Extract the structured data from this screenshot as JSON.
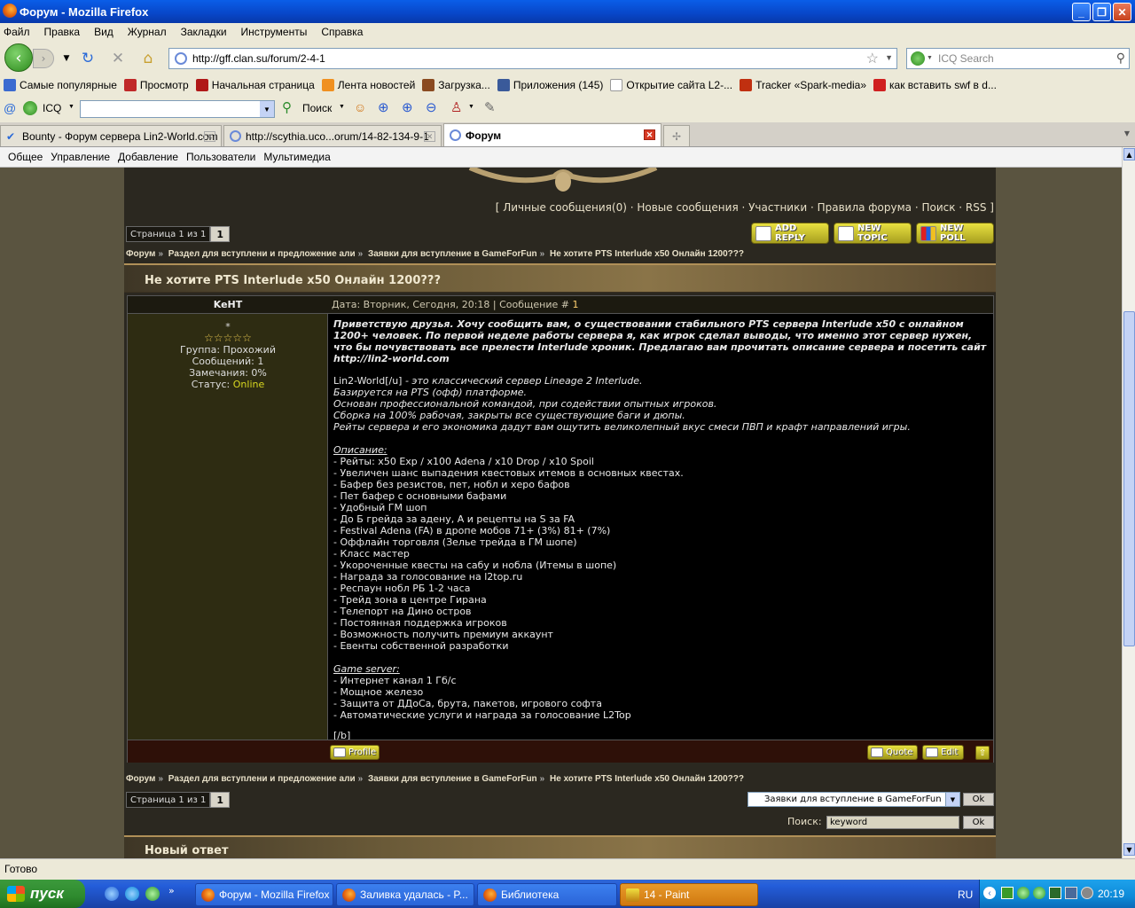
{
  "window": {
    "title": "Форум - Mozilla Firefox"
  },
  "menu": [
    "Файл",
    "Правка",
    "Вид",
    "Журнал",
    "Закладки",
    "Инструменты",
    "Справка"
  ],
  "nav": {
    "url": "http://gff.clan.su/forum/2-4-1",
    "search_placeholder": "ICQ Search"
  },
  "bookmarks": [
    {
      "label": "Самые популярные",
      "color": "#3a6ad0"
    },
    {
      "label": "Просмотр",
      "color": "#c02828"
    },
    {
      "label": "Начальная страница",
      "color": "#b01818"
    },
    {
      "label": "Лента новостей",
      "color": "#f09020"
    },
    {
      "label": "Загрузка...",
      "color": "#8a4a20"
    },
    {
      "label": "Приложения (145)",
      "color": "#3a5a9a"
    },
    {
      "label": "Открытие сайта L2-...",
      "color": "#dddddd"
    },
    {
      "label": "Tracker «Spark-media»",
      "color": "#c03010"
    },
    {
      "label": "как вставить swf в d...",
      "color": "#d02020"
    }
  ],
  "toolbar2": {
    "icq_label": "ICQ",
    "search_label": "Поиск"
  },
  "tabs": [
    {
      "label": "Bounty - Форум сервера Lin2-World.com",
      "active": false
    },
    {
      "label": "http://scythia.uco...orum/14-82-134-9-1",
      "active": false
    },
    {
      "label": "Форум",
      "active": true
    }
  ],
  "ucoz_menu": [
    "Общее",
    "Управление",
    "Добавление",
    "Пользователи",
    "Мультимедиа"
  ],
  "forum": {
    "top_links": "[ Личные сообщения(0) · Новые сообщения · Участники · Правила форума · Поиск · RSS ]",
    "pager_label": "Страница 1 из 1",
    "pager_num": "1",
    "buttons": {
      "add_reply": "ADD REPLY",
      "new_topic": "NEW TOPIC",
      "new_poll": "NEW POLL"
    },
    "breadcrumbs": [
      "Форум",
      "Раздел для вступлени и предложение али",
      "Заявки для вступление в GameForFun",
      "Не хотите PTS Interlude x50 Онлайн 1200???"
    ],
    "topic_title": "Не хотите PTS Interlude x50 Онлайн 1200???",
    "post": {
      "author": "KeHT",
      "author_mark": "*",
      "stars": "☆☆☆☆☆",
      "group": "Группа: Прохожий",
      "messages": "Сообщений: 1",
      "warnings": "Замечания: 0%",
      "status_label": "Статус:",
      "status_value": "Online",
      "date": "Дата: Вторник, Сегодня, 20:18 | Сообщение #",
      "msg_num": "1",
      "intro": "Приветствую друзья. Хочу сообщить вам, о существовании стабильного PTS сервера Interlude x50 с онлайном 1200+ человек. По первой неделе работы сервера я, как игрок сделал выводы, что именно этот сервер нужен, что бы почувствовать все прелести Interlude хроник. Предлагаю вам прочитать описание сервера и посетить сайт http://lin2-world.com",
      "about_head": "Lin2-World[/u]",
      "about_line1": " - это классический сервер Lineage 2 Interlude.",
      "about": [
        "Базируется на PTS (офф) платформе.",
        "Основан профессиональной командой, при содействии опытных игроков.",
        "Сборка на 100% рабочая, закрыты все существующие баги и дюпы.",
        "Рейты сервера и его экономика дадут вам ощутить великолепный вкус смеси ПВП и крафт направлений игры."
      ],
      "desc_head": "Описание:",
      "desc": [
        "- Рейты: x50 Exp / x100 Adena / x10 Drop / x10 Spoil",
        "- Увеличен шанс выпадения квестовых итемов в основных квестах.",
        "- Бафер без резистов, пет, нобл и херо бафов",
        "- Пет бафер с основными бафами",
        "- Удобный ГМ шоп",
        "- До Б грейда за адену, А и рецепты на S за FA",
        "- Festival Adena (FA) в дропе мобов 71+ (3%) 81+ (7%)",
        "- Оффлайн торговля (Зелье трейда в ГМ шопе)",
        "- Класс мастер",
        "- Укороченные квесты на сабу и нобла (Итемы в шопе)",
        "- Награда за голосование на l2top.ru",
        "- Респаун нобл РБ 1-2 часа",
        "- Трейд зона в центре Гирана",
        "- Телепорт на Дино остров",
        "- Постоянная поддержка игроков",
        "- Возможность получить премиум аккаунт",
        "- Евенты собственной разработки"
      ],
      "server_head": "Game server:",
      "server": [
        "- Интернет канал 1 Гб/с",
        "- Мощное железо",
        "- Защита от ДДоСа, брута, пакетов, игрового софта",
        "- Автоматические услуги и награда за голосование L2Top"
      ],
      "tail": "[/b]",
      "profile_btn": "Profile",
      "quote_btn": "Quote",
      "edit_btn": "Edit"
    },
    "jump_select": "Заявки для вступление в GameForFun",
    "ok": "Ok",
    "search_label": "Поиск:",
    "search_value": "keyword",
    "new_reply": "Новый ответ"
  },
  "status": "Готово",
  "taskbar": {
    "start": "пуск",
    "items": [
      "Форум - Mozilla Firefox",
      "Заливка удалась - P...",
      "Библиотека",
      "14 - Paint"
    ],
    "lang": "RU",
    "time": "20:19"
  }
}
